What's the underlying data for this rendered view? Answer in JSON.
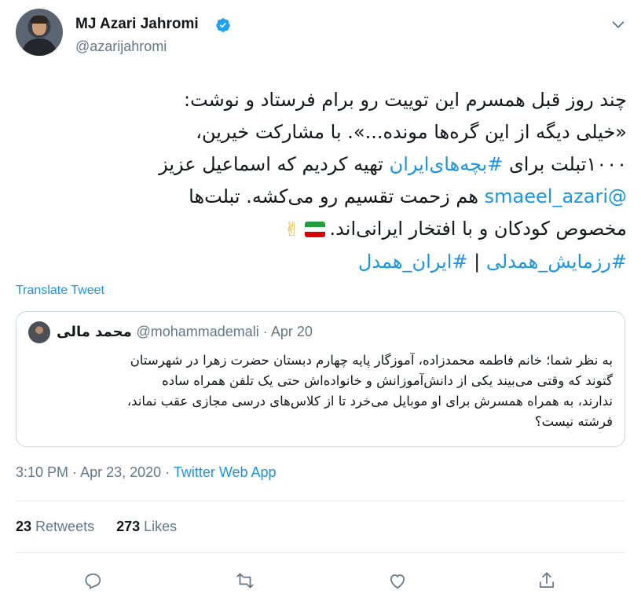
{
  "author": {
    "name": "MJ Azari Jahromi",
    "handle": "@azarijahromi",
    "verified": true,
    "avatar_icon": "profile-photo"
  },
  "tweet": {
    "lines": {
      "l1": "چند روز قبل همسرم این توییت رو برام فرستاد و نوشت:",
      "l2": "«خیلی دیگه از این گره‌ها مونده...». با مشارکت خیرین،",
      "l3_a": "۱۰۰۰تبلت برای ",
      "l3_tag": "#بچه‌های‌ایران",
      "l3_b": " تهیه کردیم که اسماعیل عزیز",
      "l4_mention": "@smaeel_azari",
      "l4_b": " هم زحمت تقسیم رو می‌کشه. تبلت‌ها",
      "l5": "مخصوص کودکان و با افتخار ایرانی‌اند.",
      "l6_tag1": "#رزمایش_همدلی",
      "l6_sep": " | ",
      "l6_tag2": "#ایران_همدل"
    },
    "emoji": [
      "flag-iran-icon",
      "victory-hand-icon"
    ],
    "victory_glyph": "✌"
  },
  "translate_label": "Translate Tweet",
  "quoted": {
    "name": "محمد مالی",
    "handle": "@mohammademali",
    "sep": " · ",
    "date": "Apr 20",
    "text_lines": [
      "به نظر شما؛ خانم فاطمه محمدزاده، آموزگار پایه چهارم دبستان حضرت زهرا در شهرستان",
      "گتوند که وقتی می‌بیند یکی از دانش‌آموزانش و خانواده‌اش حتی یک تلفن همراه ساده",
      "ندارند، به همراه همسرش برای او موبایل می‌خرد تا از کلاس‌های درسی مجازی عقب نماند،",
      "فرشته نیست؟"
    ]
  },
  "meta": {
    "time": "3:10 PM",
    "sep": " · ",
    "date": "Apr 23, 2020",
    "app": "Twitter Web App"
  },
  "stats": {
    "retweets_count": "23",
    "retweets_label": "Retweets",
    "likes_count": "273",
    "likes_label": "Likes"
  },
  "actions": [
    "reply-icon",
    "retweet-icon",
    "like-icon",
    "share-icon"
  ],
  "colors": {
    "accent": "#1b95e0",
    "verified": "#1da1f2",
    "muted": "#657786",
    "border": "#ccd6dd",
    "flag_green": "#239f40",
    "flag_white": "#ffffff",
    "flag_red": "#da0000"
  }
}
